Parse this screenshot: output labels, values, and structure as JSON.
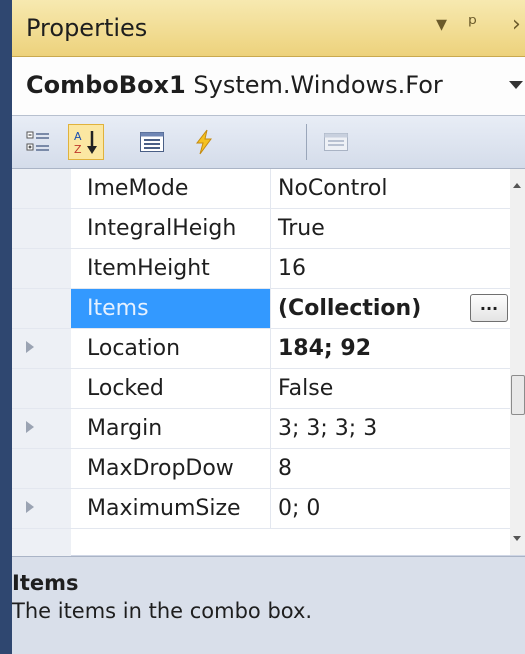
{
  "window": {
    "title": "Properties",
    "controls": [
      "▾",
      "ᵖ",
      "›"
    ]
  },
  "object_selector": {
    "name": "ComboBox1",
    "type": "System.Windows.For"
  },
  "toolbar": {
    "buttons": [
      "categorized-icon",
      "alphabetical-icon",
      "properties-icon",
      "events-icon",
      "property-pages-icon"
    ],
    "active": "alphabetical-icon"
  },
  "properties": [
    {
      "name": "ImeMode",
      "value": "NoControl",
      "expandable": false
    },
    {
      "name": "IntegralHeigh",
      "value": "True",
      "expandable": false
    },
    {
      "name": "ItemHeight",
      "value": "16",
      "expandable": false
    },
    {
      "name": "Items",
      "value": "(Collection)",
      "expandable": false,
      "selected": true,
      "bold": true,
      "has_ellipsis": true,
      "ellipsis": "..."
    },
    {
      "name": "Location",
      "value": "184; 92",
      "expandable": true,
      "bold": true
    },
    {
      "name": "Locked",
      "value": "False",
      "expandable": false
    },
    {
      "name": "Margin",
      "value": "3; 3; 3; 3",
      "expandable": true
    },
    {
      "name": "MaxDropDow",
      "value": "8",
      "expandable": false
    },
    {
      "name": "MaximumSize",
      "value": "0; 0",
      "expandable": true
    }
  ],
  "description": {
    "title": "Items",
    "text": "The items in the combo box."
  },
  "colors": {
    "title_bar": "#edd27c",
    "selected_row": "#3399ff",
    "window_edge": "#2f4770"
  }
}
